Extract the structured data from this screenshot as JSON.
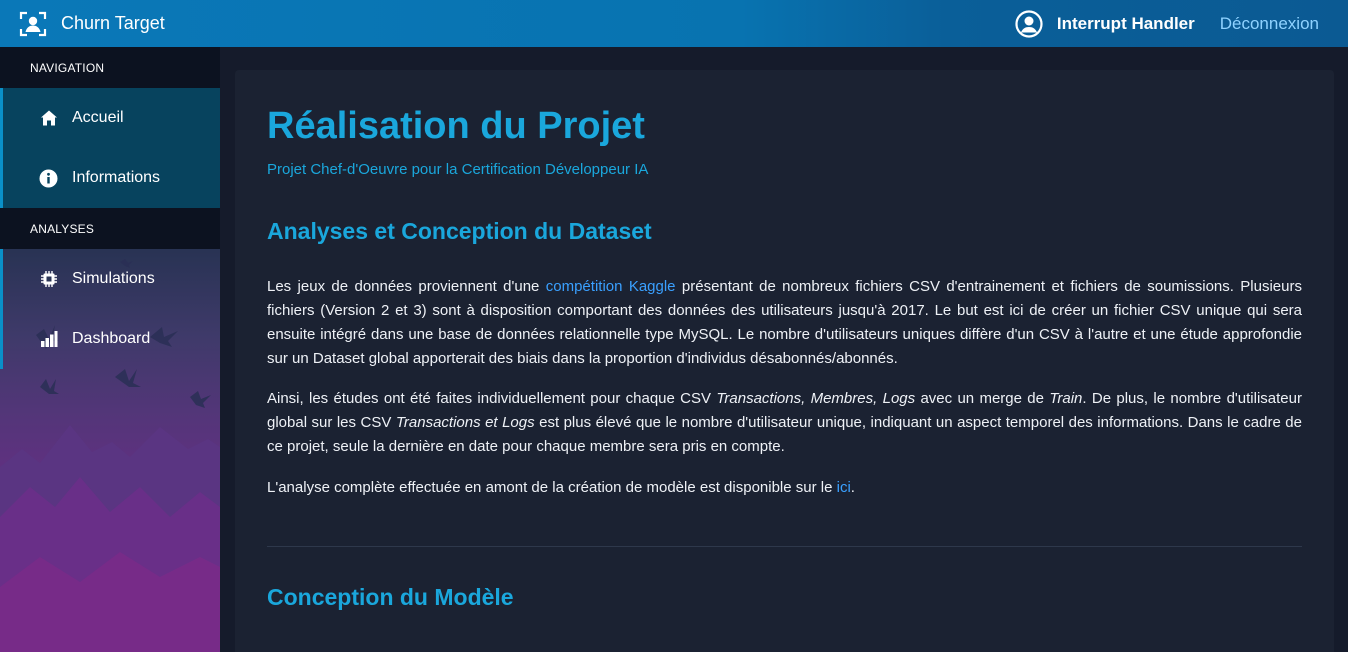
{
  "header": {
    "app_title": "Churn Target",
    "user_name": "Interrupt Handler",
    "logout_label": "Déconnexion"
  },
  "sidebar": {
    "sections": [
      {
        "title": "NAVIGATION",
        "items": [
          {
            "label": "Accueil",
            "icon": "home-icon"
          },
          {
            "label": "Informations",
            "icon": "info-icon"
          }
        ]
      },
      {
        "title": "ANALYSES",
        "items": [
          {
            "label": "Simulations",
            "icon": "chip-icon"
          },
          {
            "label": "Dashboard",
            "icon": "bar-chart-icon"
          }
        ]
      }
    ]
  },
  "main": {
    "title": "Réalisation du Projet",
    "subtitle": "Projet Chef-d'Oeuvre pour la Certification Développeur IA",
    "section1": {
      "heading": "Analyses et Conception du Dataset",
      "p1": {
        "before": "Les jeux de données proviennent d'une ",
        "link": "compétition Kaggle",
        "after": " présentant de nombreux fichiers CSV d'entrainement et fichiers de soumissions. Plusieurs fichiers (Version 2 et 3) sont à disposition comportant des données des utilisateurs jusqu'à 2017. Le but est ici de créer un fichier CSV unique qui sera ensuite intégré dans une base de données relationnelle type MySQL. Le nombre d'utilisateurs uniques diffère d'un CSV à l'autre et une étude approfondie sur un Dataset global apporterait des biais dans la proportion d'individus désabonnés/abonnés."
      },
      "p2": {
        "t1": "Ainsi, les études ont été faites individuellement pour chaque CSV ",
        "i1": "Transactions, Membres, Logs",
        "t2": " avec un merge de ",
        "i2": "Train",
        "t3": ". De plus, le nombre d'utilisateur global sur les CSV ",
        "i3": "Transactions et Logs",
        "t4": " est plus élevé que le nombre d'utilisateur unique, indiquant un aspect temporel des informations. Dans le cadre de ce projet, seule la dernière en date pour chaque membre sera pris en compte."
      },
      "p3": {
        "before": "L'analyse complète effectuée en amont de la création de modèle est disponible sur le ",
        "link": "ici",
        "after": "."
      }
    },
    "section2": {
      "heading": "Conception du Modèle"
    }
  },
  "colors": {
    "accent": "#1aa7dc",
    "link": "#3aa0ff",
    "topbar": "#0a78b8",
    "card": "#1b2232"
  }
}
